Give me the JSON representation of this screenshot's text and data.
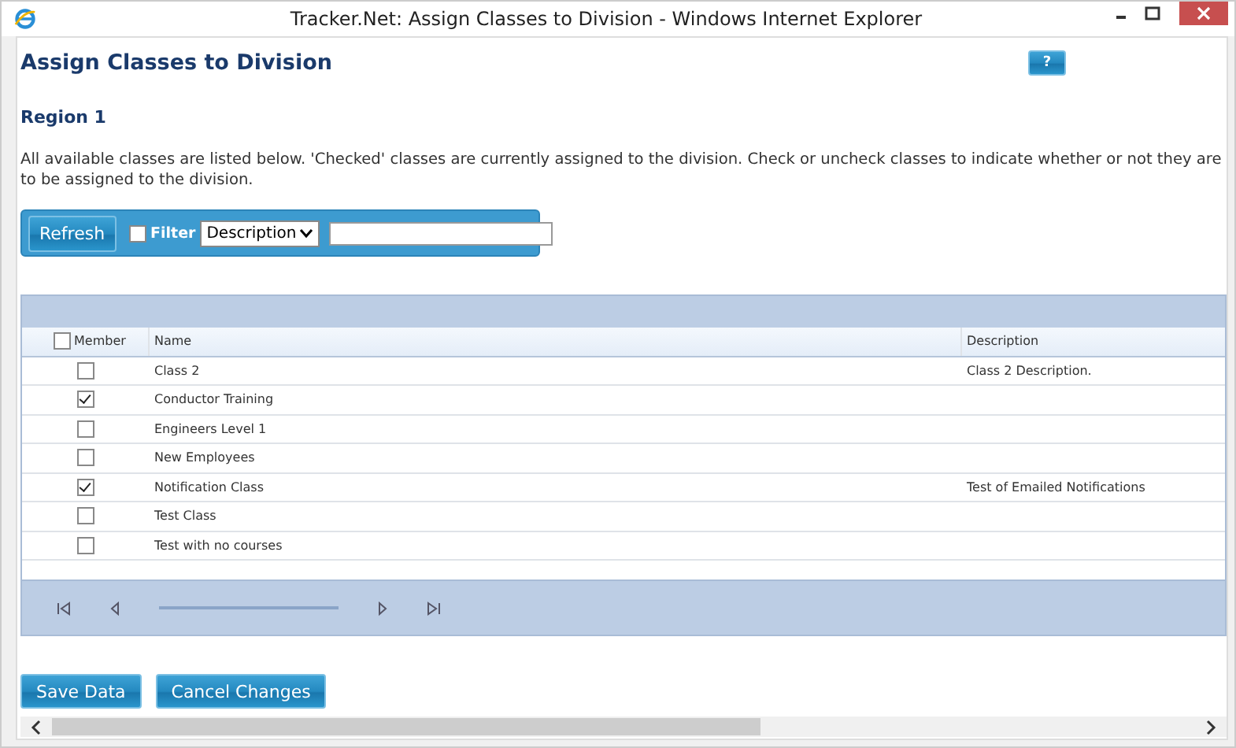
{
  "window": {
    "title": "Tracker.Net: Assign Classes to Division - Windows Internet Explorer"
  },
  "page": {
    "heading": "Assign Classes to Division",
    "help_button": "?",
    "subheading": "Region 1",
    "intro": "All available classes are listed below. 'Checked' classes are currently assigned to the division. Check or uncheck classes to indicate whether or not they are to be assigned to the division."
  },
  "toolbar": {
    "refresh": "Refresh",
    "filter_label": "Filter",
    "filter_checked": false,
    "filter_field": "Description"
  },
  "table": {
    "columns": [
      "Member",
      "Name",
      "Description"
    ],
    "all_checked": false,
    "rows": [
      {
        "checked": false,
        "name": "Class 2",
        "description": "Class 2 Description."
      },
      {
        "checked": true,
        "name": "Conductor Training",
        "description": ""
      },
      {
        "checked": false,
        "name": "Engineers Level 1",
        "description": ""
      },
      {
        "checked": false,
        "name": "New Employees",
        "description": ""
      },
      {
        "checked": true,
        "name": "Notification Class",
        "description": "Test of Emailed Notifications"
      },
      {
        "checked": false,
        "name": "Test Class",
        "description": ""
      },
      {
        "checked": false,
        "name": "Test with no courses",
        "description": ""
      }
    ]
  },
  "buttons": [
    "Save Data",
    "Cancel Changes"
  ]
}
